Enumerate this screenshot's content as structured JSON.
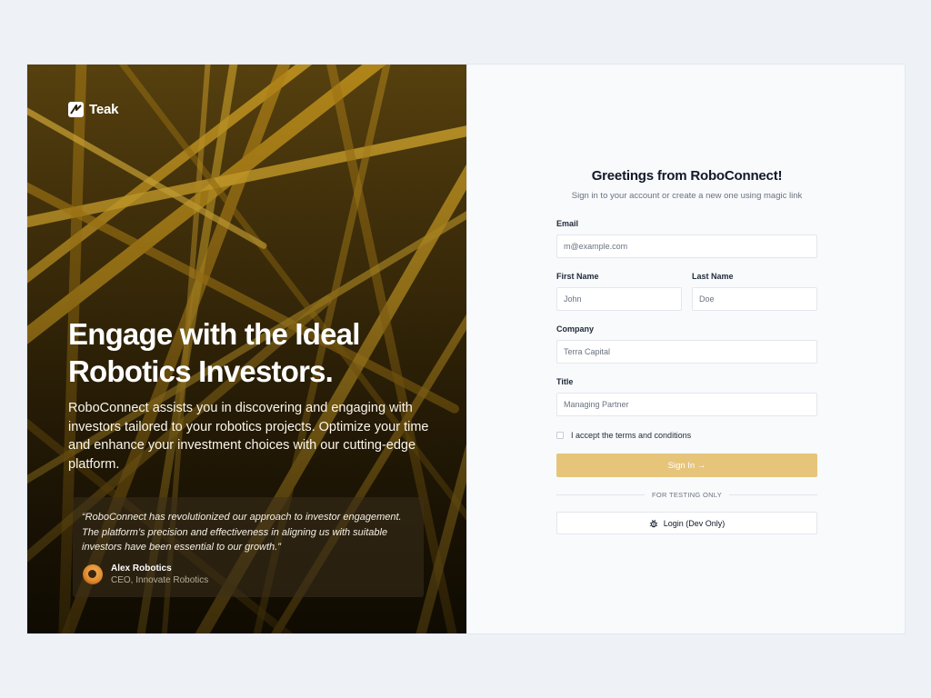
{
  "brand": {
    "name": "Teak"
  },
  "hero": {
    "title": "Engage with the Ideal Robotics Investors.",
    "body": "RoboConnect assists you in discovering and engaging with investors tailored to your robotics projects. Optimize your time and enhance your investment choices with our cutting-edge platform.",
    "testimonial": {
      "quote": "“RoboConnect has revolutionized our approach to investor engagement. The platform’s precision and effectiveness in aligning us with suitable investors have been essential to our growth.”",
      "author_name": "Alex Robotics",
      "author_role": "CEO, Innovate Robotics"
    }
  },
  "form": {
    "title": "Greetings from RoboConnect!",
    "subtitle": "Sign in to your account or create a new one using magic link",
    "email": {
      "label": "Email",
      "placeholder": "m@example.com"
    },
    "first_name": {
      "label": "First Name",
      "placeholder": "John"
    },
    "last_name": {
      "label": "Last Name",
      "placeholder": "Doe"
    },
    "company": {
      "label": "Company",
      "placeholder": "Terra Capital"
    },
    "title_field": {
      "label": "Title",
      "placeholder": "Managing Partner"
    },
    "terms_label": "I accept the terms and conditions",
    "signin_label": "Sign In →",
    "divider_label": "FOR TESTING ONLY",
    "dev_login_label": "Login (Dev Only)"
  },
  "colors": {
    "accent": "#e6c57b",
    "page_background": "#eef2f7",
    "hero_gold": "#c9981c"
  },
  "icons": {
    "logo": "teak-logo-icon",
    "dev_login": "bug-icon",
    "arrow": "arrow-right-icon"
  }
}
